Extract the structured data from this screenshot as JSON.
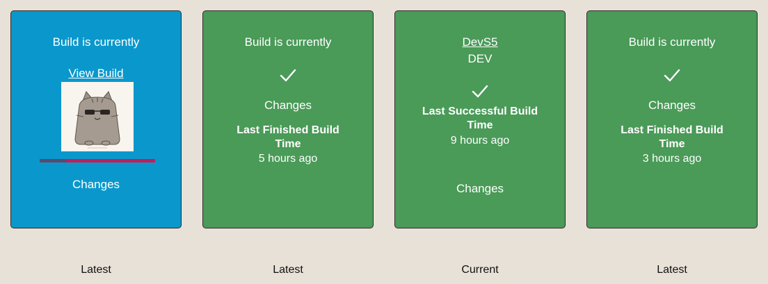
{
  "cards": [
    {
      "title": "Build is currently",
      "view_build": "View Build",
      "progress": 0.23,
      "changes": "Changes",
      "footer": "Latest",
      "color": "#0a98cc"
    },
    {
      "title": "Build is currently",
      "changes": "Changes",
      "bold_line1": "Last Finished Build",
      "bold_line2": "Time",
      "time": "5 hours ago",
      "footer": "Latest",
      "color": "#4a9a58"
    },
    {
      "link": "DevS5",
      "env": "DEV",
      "bold_line1": "Last Successful Build",
      "bold_line2": "Time",
      "time": "9 hours ago",
      "changes": "Changes",
      "footer": "Current",
      "color": "#4a9a58"
    },
    {
      "title": "Build is currently",
      "changes": "Changes",
      "bold_line1": "Last Finished Build",
      "bold_line2": "Time",
      "time": "3 hours ago",
      "footer": "Latest",
      "color": "#4a9a58"
    }
  ],
  "icons": {
    "status_success": "checkmark-icon",
    "building_image": "pusheen-cat-image"
  }
}
